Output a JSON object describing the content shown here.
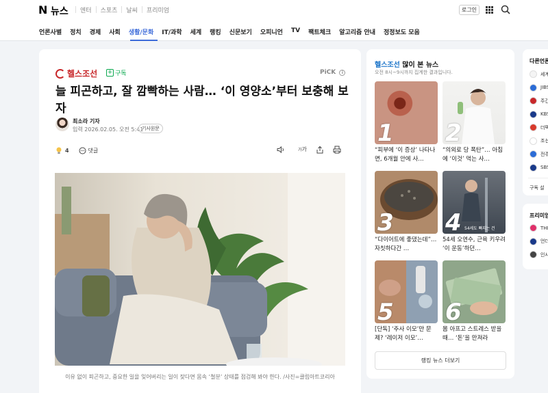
{
  "header": {
    "logo_n": "N",
    "logo_news": "뉴스",
    "top_menu": [
      "엔터",
      "스포츠",
      "날씨",
      "프리미엄"
    ],
    "login": "로그인"
  },
  "nav": {
    "items": [
      "언론사별",
      "정치",
      "경제",
      "사회",
      "생활/문화",
      "IT/과학",
      "세계",
      "랭킹",
      "신문보기",
      "오피니언",
      "TV",
      "팩트체크",
      "알고리즘 안내",
      "정정보도 모음"
    ],
    "active_index": 4
  },
  "article": {
    "publisher": "헬스조선",
    "subscribe": "구독",
    "pick": "PiCK",
    "headline": "늘 피곤하고, 잘 깜빡하는 사람… ‘이 영양소’부터 보충해 보자",
    "reporter": "최소라 기자",
    "date": "입력 2026.02.05. 오전 5:41",
    "origin_button": "기사원문",
    "reaction_count": "4",
    "comment_label": "댓글",
    "font_label": "가",
    "caption": "이유 없이 피곤하고, 중요한 일을 잊어버리는 일이 잦다면 몸속 ‘철분’ 상태를 점검해 봐야 한다. /사진=클립아트코리아"
  },
  "ranking": {
    "publisher": "헬스조선",
    "title_suffix": " 많이 본 뉴스",
    "subtitle": "오전 8시~9시까지 집계한 결과입니다.",
    "items": [
      {
        "num": "1",
        "text": "“피부에 ‘이 증상’ 나타나면, 6개월 안에 사…"
      },
      {
        "num": "2",
        "text": "“의외로 당 폭탄”… 아침에 ‘이것’ 먹는 사…"
      },
      {
        "num": "3",
        "text": "“다이어트에 좋댔는데”… 자칫하다간 …"
      },
      {
        "num": "4",
        "text": "54세 오연수, 근육 키우려 ‘이 운동’하던…"
      },
      {
        "num": "5",
        "text": "[단독] ‘주사 이모’만 문제? ‘레이저 이모’…"
      },
      {
        "num": "6",
        "text": "몸 아프고 스트레스 받을 때… ‘돈’을 만져라"
      }
    ],
    "thumb4_overlay": "54세도 빠지는 건",
    "more": "랭킹 뉴스 더보기"
  },
  "side": {
    "title1": "다른언론",
    "items1": [
      {
        "label": "세계",
        "color": "#f4f4f4"
      },
      {
        "label": "JIBS",
        "color": "#2b6cd6"
      },
      {
        "label": "주간",
        "color": "#c8282b"
      },
      {
        "label": "KBS",
        "color": "#1a3a8a"
      },
      {
        "label": "더팩",
        "color": "#d83a2c"
      },
      {
        "label": "조선",
        "color": "#ffffff"
      },
      {
        "label": "전주",
        "color": "#2b6cd6"
      },
      {
        "label": "SBS",
        "color": "#1a3a8a"
      }
    ],
    "subscribe_setting": "구독 설",
    "title2": "프리미엄",
    "items2": [
      {
        "label": "THE",
        "color": "#e0306a"
      },
      {
        "label": "언더",
        "color": "#1a3a8a"
      },
      {
        "label": "인사",
        "color": "#444444"
      }
    ]
  },
  "colors": {
    "accent": "#3d6bd9",
    "publisher_red": "#c8282b",
    "subscribe_green": "#0aa84f",
    "rank_publisher_blue": "#1a73c8"
  }
}
